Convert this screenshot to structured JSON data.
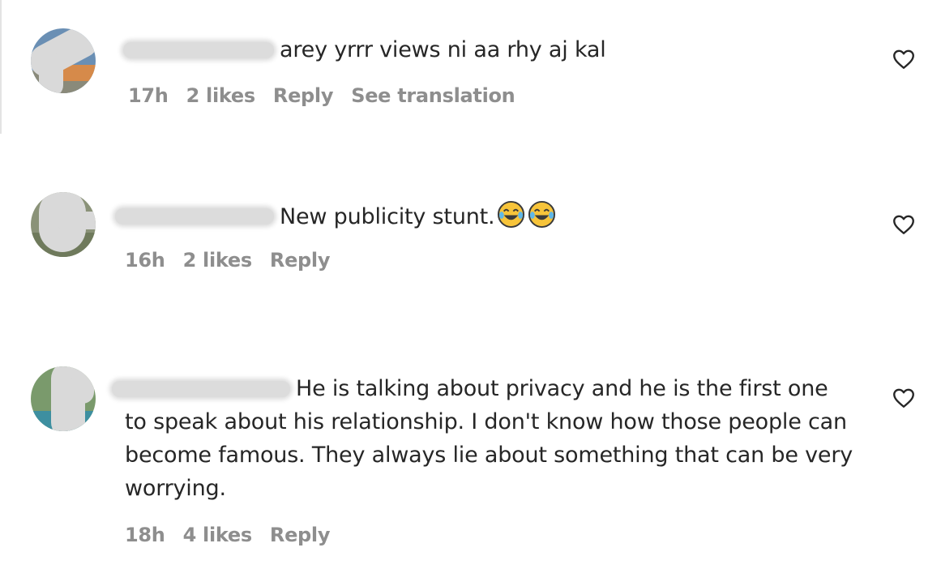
{
  "comments": [
    {
      "text": "arey yrrr views ni aa rhy aj kal",
      "time": "17h",
      "likes": "2 likes",
      "reply": "Reply",
      "translate": "See translation"
    },
    {
      "text": "New publicity stunt.",
      "emojis": "😂😂",
      "emoji_icon": "face-with-tears-of-joy-icon",
      "time": "16h",
      "likes": "2 likes",
      "reply": "Reply"
    },
    {
      "text": "He is talking about privacy and he is the first one to speak about his relationship. I don't know how those people can become famous. They always lie about something that can be very worrying.",
      "time": "18h",
      "likes": "4 likes",
      "reply": "Reply"
    }
  ],
  "colors": {
    "text": "#262626",
    "meta": "#8e8e8e",
    "redaction": "#d9d9d9"
  }
}
